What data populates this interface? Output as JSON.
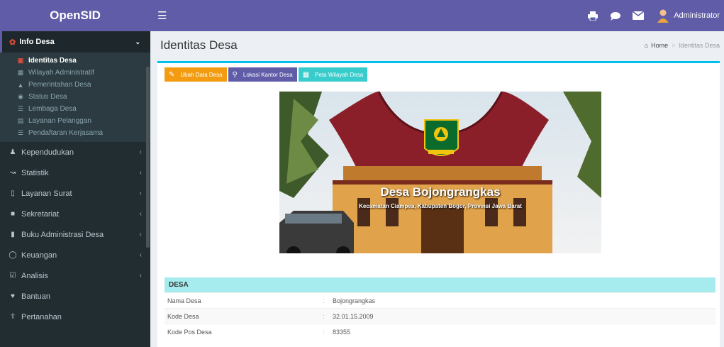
{
  "app": {
    "name": "OpenSID",
    "accent": "#605ca8",
    "sidebar_bg": "#222d32"
  },
  "topbar": {
    "menu_icon": "hamburger-icon",
    "icons": [
      {
        "name": "print-icon",
        "badge": ""
      },
      {
        "name": "comment-icon",
        "badge": ""
      },
      {
        "name": "mail-icon",
        "badge": ""
      }
    ],
    "user_name": "Administrator"
  },
  "sidebar": {
    "active_group": {
      "label": "Info Desa",
      "icon": "sitemap-icon"
    },
    "subitems": [
      {
        "label": "Identitas Desa",
        "icon": "id-card-icon",
        "active": true
      },
      {
        "label": "Wilayah Administratif",
        "icon": "map-icon"
      },
      {
        "label": "Pemerintahan Desa",
        "icon": "sitemap-icon"
      },
      {
        "label": "Status Desa",
        "icon": "dashboard-icon"
      },
      {
        "label": "Lembaga Desa",
        "icon": "list-icon"
      },
      {
        "label": "Layanan Pelanggan",
        "icon": "credit-card-icon"
      },
      {
        "label": "Pendaftaran Kerjasama",
        "icon": "list-icon"
      }
    ],
    "items": [
      {
        "label": "Kependudukan",
        "icon": "users-icon"
      },
      {
        "label": "Statistik",
        "icon": "line-chart-icon"
      },
      {
        "label": "Layanan Surat",
        "icon": "book-icon"
      },
      {
        "label": "Sekretariat",
        "icon": "archive-icon"
      },
      {
        "label": "Buku Administrasi Desa",
        "icon": "bookmark-icon"
      },
      {
        "label": "Keuangan",
        "icon": "money-icon"
      },
      {
        "label": "Analisis",
        "icon": "check-square-icon"
      },
      {
        "label": "Bantuan",
        "icon": "heart-icon"
      },
      {
        "label": "Pertanahan",
        "icon": "map-signs-icon"
      }
    ]
  },
  "page": {
    "title": "Identitas Desa",
    "breadcrumb": {
      "home": "Home",
      "current": "Identitas Desa"
    }
  },
  "actions": [
    {
      "label": "Ubah Data Desa",
      "icon": "edit-icon",
      "color": "#f39c12"
    },
    {
      "label": "Lokasi Kantor Desa",
      "icon": "map-marker-icon",
      "color": "#605ca8"
    },
    {
      "label": "Peta Wilayah Desa",
      "icon": "map-icon",
      "color": "#39cccc"
    }
  ],
  "banner": {
    "title": "Desa Bojongrangkas",
    "subtitle": "Kecamatan Ciampea, Kabupaten Bogor, Provinsi Jawa Barat"
  },
  "table": {
    "section": "DESA",
    "rows": [
      {
        "label": "Nama Desa",
        "value": "Bojongrangkas"
      },
      {
        "label": "Kode Desa",
        "value": "32.01.15.2009"
      },
      {
        "label": "Kode Pos Desa",
        "value": "83355"
      }
    ]
  }
}
